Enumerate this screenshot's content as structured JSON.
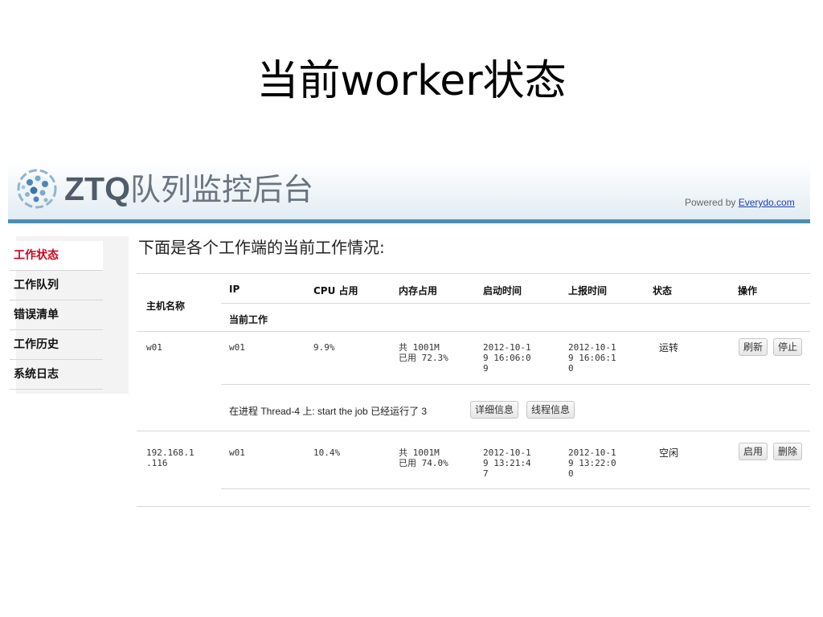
{
  "slide_title": "当前worker状态",
  "app": {
    "brand": "ZTQ",
    "brand_cn": "队列监控后台",
    "powered_prefix": "Powered by ",
    "powered_link": "Everydo.com"
  },
  "sidebar": {
    "items": [
      {
        "label": "工作状态",
        "active": true
      },
      {
        "label": "工作队列",
        "active": false
      },
      {
        "label": "错误清单",
        "active": false
      },
      {
        "label": "工作历史",
        "active": false
      },
      {
        "label": "系统日志",
        "active": false
      }
    ]
  },
  "main": {
    "heading": "下面是各个工作端的当前工作情况:",
    "columns": {
      "host": "主机名称",
      "ip": "IP",
      "cpu": "CPU 占用",
      "mem": "内存占用",
      "start": "启动时间",
      "report": "上报时间",
      "status": "状态",
      "actions": "操作",
      "current_work": "当前工作"
    },
    "rows": [
      {
        "host": "w01",
        "ip": "w01",
        "cpu": "9.9%",
        "mem": "共 1001M\n已用 72.3%",
        "start": "2012-10-1\n9 16:06:0\n9",
        "report": "2012-10-1\n9 16:06:1\n0",
        "status": "运转",
        "buttons": [
          "刷新",
          "停止"
        ],
        "current_work": "在进程 Thread-4 上:  start the job 已经运行了 3",
        "work_buttons": [
          "详细信息",
          "线程信息"
        ]
      },
      {
        "host": "192.168.1\n.116",
        "ip": "w01",
        "cpu": "10.4%",
        "mem": "共 1001M\n已用 74.0%",
        "start": "2012-10-1\n9 13:21:4\n7",
        "report": "2012-10-1\n9 13:22:0\n0",
        "status": "空闲",
        "buttons": [
          "启用",
          "删除"
        ]
      }
    ]
  },
  "colors": {
    "accent_bar": "#4f8db3",
    "active_menu": "#d0021b",
    "link": "#1a3fb5"
  }
}
